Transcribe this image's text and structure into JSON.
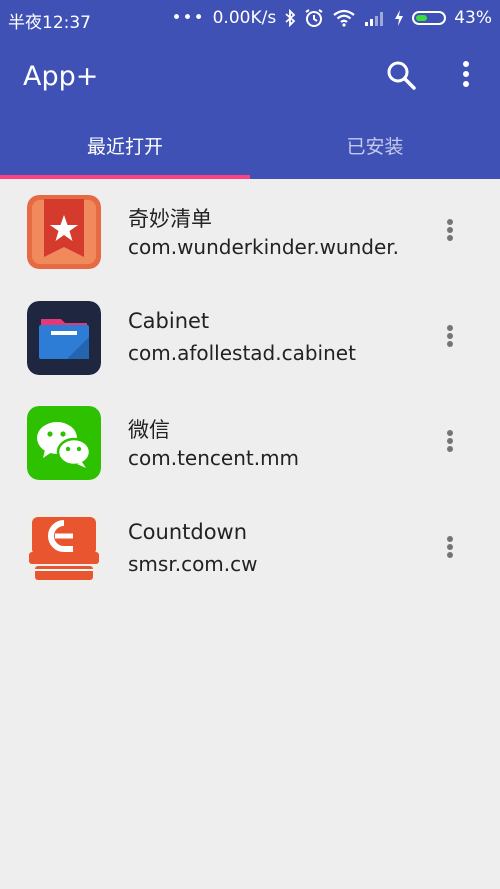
{
  "status_bar": {
    "time": "半夜12:37",
    "speed": "0.00K/s",
    "battery": "43%",
    "battery_level": 0.43
  },
  "app_bar": {
    "title": "App+",
    "icons": [
      "search-icon",
      "more-vert-icon"
    ]
  },
  "tabs": [
    {
      "label": "最近打开",
      "selected": true
    },
    {
      "label": "已安装",
      "selected": false
    }
  ],
  "colors": {
    "primary": "#3f51b5",
    "indicator": "#ff4081",
    "background": "#eeeeee"
  },
  "apps": [
    {
      "name": "奇妙清单",
      "package": "com.wunderkinder.wunder.",
      "icon": "wunderlist-icon"
    },
    {
      "name": "Cabinet",
      "package": "com.afollestad.cabinet",
      "icon": "cabinet-icon"
    },
    {
      "name": "微信",
      "package": "com.tencent.mm",
      "icon": "wechat-icon"
    },
    {
      "name": "Countdown",
      "package": "smsr.com.cw",
      "icon": "countdown-icon"
    }
  ]
}
